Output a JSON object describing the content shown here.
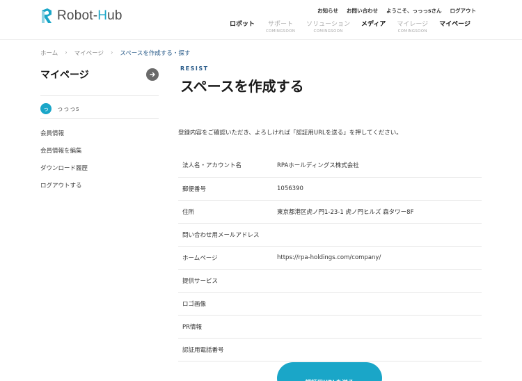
{
  "header": {
    "logo_prefix": "Robot-",
    "logo_accent": "H",
    "logo_suffix": "ub",
    "top_links": [
      "お知らせ",
      "お問い合わせ",
      "ようこそ、っっっsさん",
      "ログアウト"
    ],
    "nav": [
      {
        "label": "ロボット",
        "sub": "",
        "disabled": false
      },
      {
        "label": "サポート",
        "sub": "COMINGSOON",
        "disabled": true
      },
      {
        "label": "ソリューション",
        "sub": "COMINGSOON",
        "disabled": true
      },
      {
        "label": "メディア",
        "sub": "",
        "disabled": false
      },
      {
        "label": "マイレージ",
        "sub": "COMINGSOON",
        "disabled": true
      },
      {
        "label": "マイページ",
        "sub": "",
        "disabled": false
      }
    ]
  },
  "breadcrumb": {
    "home": "ホーム",
    "mypage": "マイページ",
    "current": "スペースを作成する・探す"
  },
  "sidebar": {
    "title": "マイページ",
    "avatar_letter": "っ",
    "username": "っっっs",
    "menu": [
      "会員情報",
      "会員情報を編集",
      "ダウンロード履歴",
      "ログアウトする"
    ]
  },
  "main": {
    "kicker": "RESIST",
    "title": "スペースを作成する",
    "intro": "登録内容をご確認いただき、よろしければ「認証用URLを送る」を押してください。",
    "rows": [
      {
        "label": "法人名・アカウント名",
        "value": "RPAホールディングス株式会社"
      },
      {
        "label": "郵便番号",
        "value": "1056390"
      },
      {
        "label": "住所",
        "value": "東京都港区虎ノ門1-23-1 虎ノ門ヒルズ 森タワー8F"
      },
      {
        "label": "問い合わせ用メールアドレス",
        "value": ""
      },
      {
        "label": "ホームページ",
        "value": "https://rpa-holdings.com/company/"
      },
      {
        "label": "提供サービス",
        "value": ""
      },
      {
        "label": "ロゴ画像",
        "value": ""
      },
      {
        "label": "PR情報",
        "value": ""
      },
      {
        "label": "認証用電話番号",
        "value": ""
      }
    ],
    "submit_label": "認証用URLを送る"
  },
  "colors": {
    "accent": "#1aa6c8",
    "link": "#2a5c8a"
  },
  "icons": {
    "logo": "robot-hub-logo-icon",
    "sidebar_arrow": "arrow-right-icon",
    "breadcrumb_sep": "chevron-right-icon"
  }
}
